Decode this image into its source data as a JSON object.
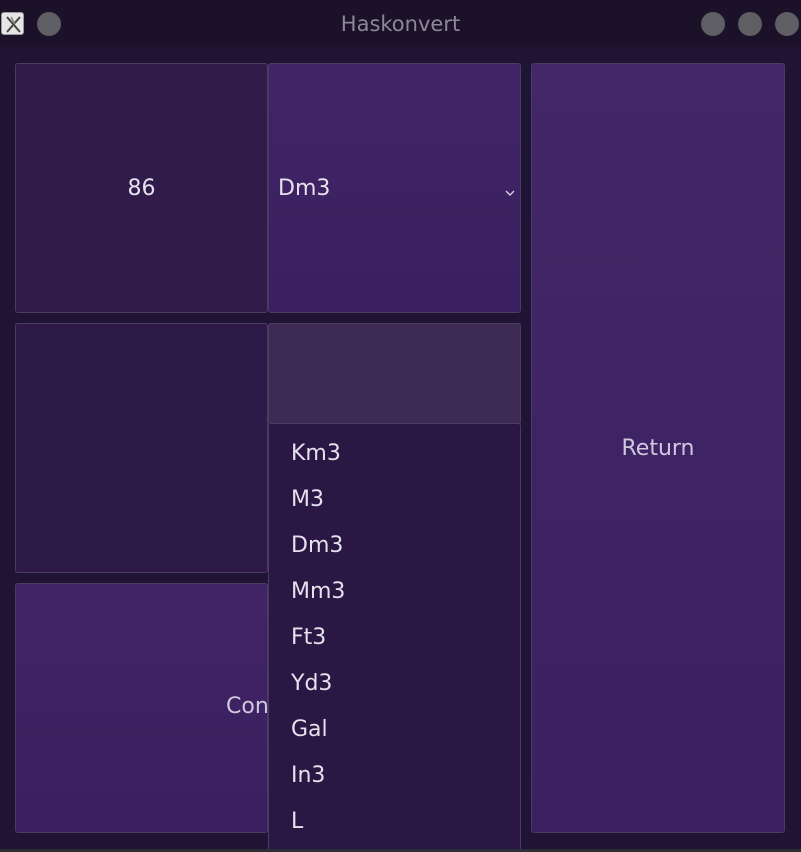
{
  "window": {
    "title": "Haskonvert"
  },
  "icons": {
    "app": "haskell-x-icon",
    "menu": "circle-button-icon",
    "minimize": "circle-button-icon",
    "maximize": "circle-button-icon",
    "close": "circle-button-icon",
    "chevron": "chevron-down-icon"
  },
  "converter": {
    "input_value": "86",
    "from_unit": "Dm3",
    "result_value": "",
    "convert_label": "Convert",
    "return_label": "Return"
  },
  "dropdown": {
    "items": [
      "Km3",
      "M3",
      "Dm3",
      "Mm3",
      "Ft3",
      "Yd3",
      "Gal",
      "In3",
      "L"
    ]
  },
  "colors": {
    "background": "#201434",
    "accent": "#3c2262",
    "dropdown": "#2a1743",
    "text": "#e6e1ee"
  }
}
